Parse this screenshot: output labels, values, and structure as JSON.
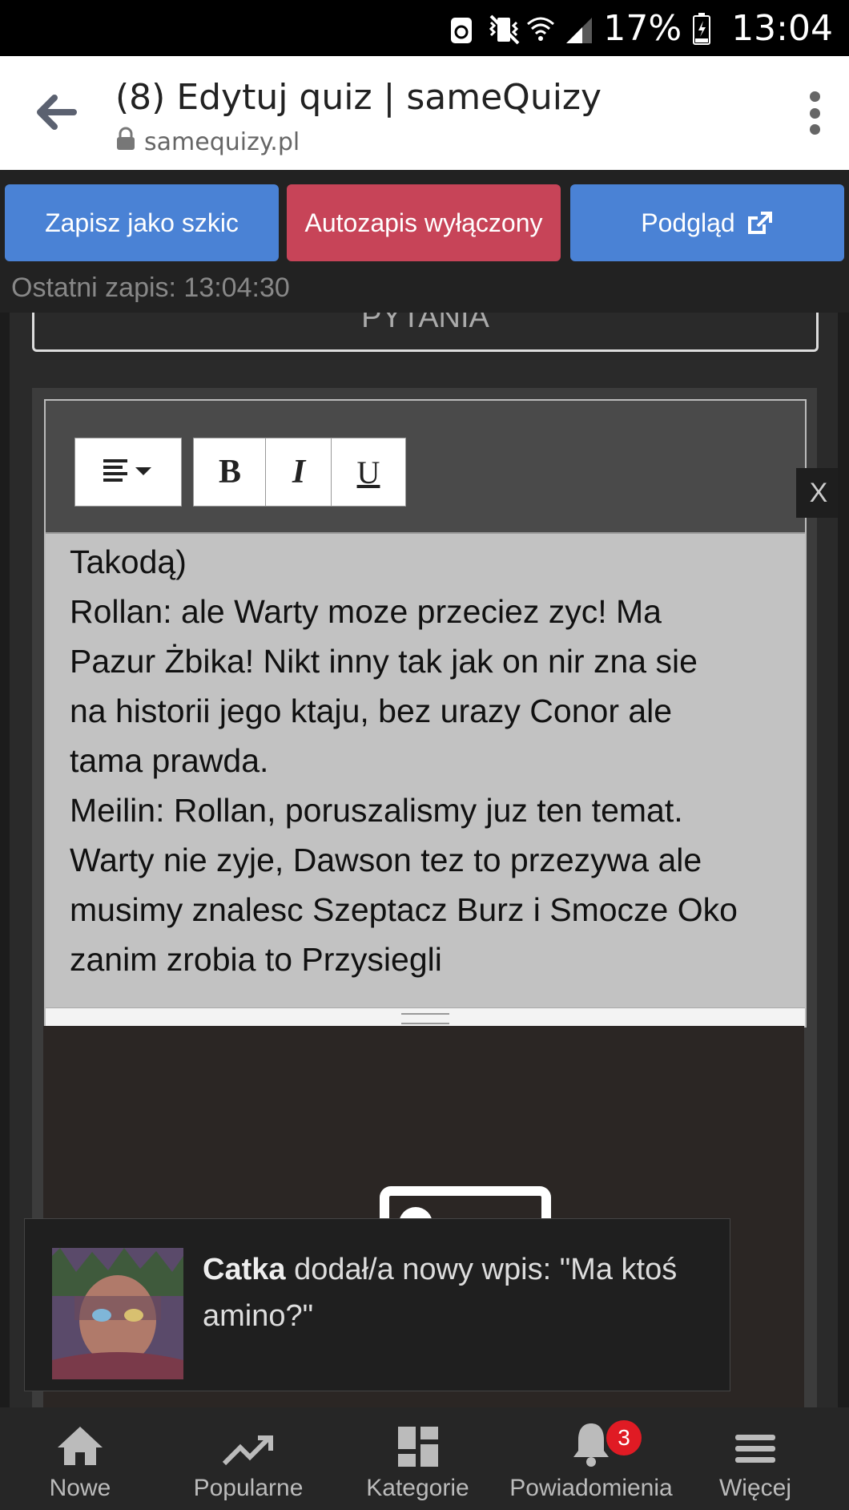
{
  "status": {
    "battery": "17%",
    "time": "13:04"
  },
  "browser": {
    "title": "(8) Edytuj quiz | sameQuizy",
    "url": "samequizy.pl"
  },
  "toolbar": {
    "draft_label": "Zapisz jako szkic",
    "autosave_label": "Autozapis wyłączony",
    "preview_label": "Podgląd",
    "last_save": "Ostatni zapis: 13:04:30"
  },
  "section_title": "PYTANIA",
  "editor": {
    "close_label": "X",
    "bold_label": "B",
    "italic_label": "I",
    "underline_label": "U",
    "lines": [
      "Takodą)",
      "Rollan: ale Warty moze przeciez zyc! Ma",
      "Pazur Żbika! Nikt inny tak jak on nir zna sie",
      "na historii jego ktaju, bez urazy Conor ale",
      "tama prawda.",
      "Meilin: Rollan, poruszalismy juz ten temat.",
      "Warty nie zyje, Dawson tez to przezywa ale",
      "musimy znalesc Szeptacz Burz i Smocze Oko",
      "zanim zrobia to Przysiegli"
    ]
  },
  "notification": {
    "user": "Catka",
    "line1": "dodał/a nowy wpis: \"Ma ktoś",
    "line2": "amino?\""
  },
  "bottom_nav": {
    "items": [
      {
        "label": "Nowe",
        "icon": "home-icon"
      },
      {
        "label": "Popularne",
        "icon": "trending-icon"
      },
      {
        "label": "Kategorie",
        "icon": "grid-icon"
      },
      {
        "label": "Powiadomienia",
        "icon": "bell-icon"
      },
      {
        "label": "Więcej",
        "icon": "menu-icon"
      }
    ],
    "notifications_badge": "3"
  },
  "colors": {
    "primary": "#4a82d5",
    "danger": "#c74458",
    "badge": "#e01b24"
  }
}
